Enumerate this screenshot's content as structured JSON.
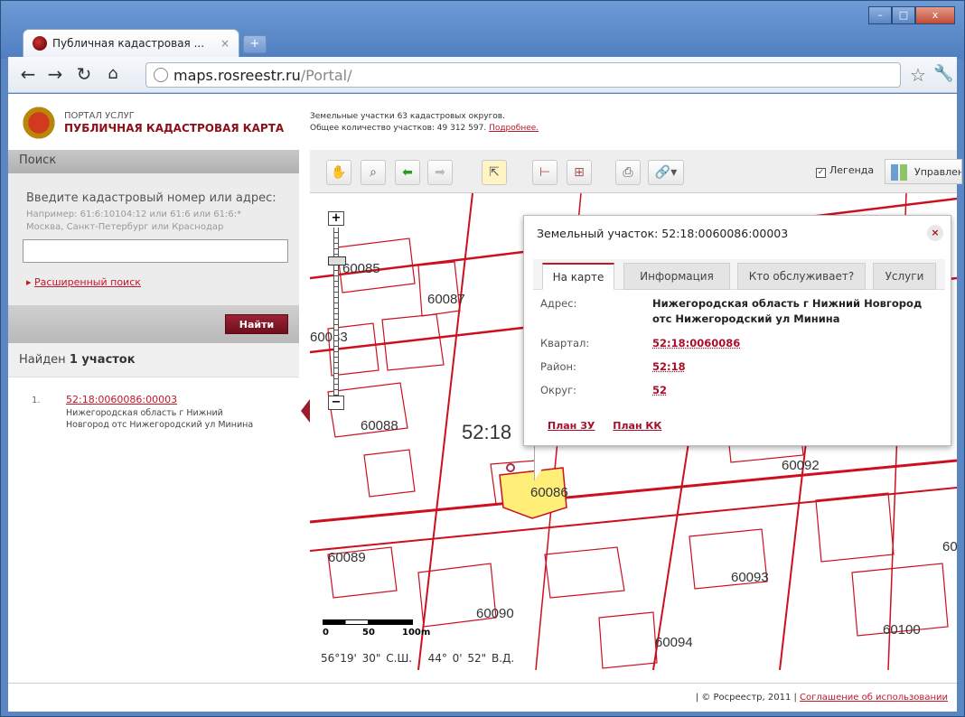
{
  "browser": {
    "tab_title": "Публичная кадастровая ...",
    "tab_close": "×",
    "new_tab": "+",
    "url_domain": "maps.rosreestr.ru",
    "url_path": "/Portal/",
    "win_min": "–",
    "win_max": "□",
    "win_close": "x"
  },
  "header": {
    "portal": "ПОРТАЛ УСЛУГ",
    "title": "ПУБЛИЧНАЯ КАДАСТРОВАЯ КАРТА",
    "info_line1": "Земельные участки 63 кадастровых округов.",
    "info_line2": "Общее количество участков: 49 312 597.",
    "info_more": "Подробнее."
  },
  "sidebar": {
    "title": "Поиск",
    "prompt": "Введите кадастровый номер или адрес:",
    "example1": "Например: 61:6:10104:12 или 61:6 или 61:6:*",
    "example2": "Москва, Санкт-Петербург или Краснодар",
    "advanced": "Расширенный поиск",
    "find_button": "Найти",
    "found_prefix": "Найден",
    "found_count": "1 участок",
    "result": {
      "index": "1.",
      "number": "52:18:0060086:00003",
      "address1": "Нижегородская область г Нижний",
      "address2": "Новгород отс Нижегородский ул Минина"
    }
  },
  "map_toolbar": {
    "legend": "Легенда",
    "management": "Управление"
  },
  "map": {
    "labels": [
      "60085",
      "60087",
      "60083",
      "60088",
      "52:18",
      "60086",
      "60092",
      "60089",
      "60090",
      "60093",
      "60094",
      "60100",
      "60"
    ],
    "scale": [
      "0",
      "50",
      "100m"
    ],
    "lat": "56°19' 30\" С.Ш.",
    "lon": "44° 0' 52\" В.Д."
  },
  "popup": {
    "title": "Земельный участок: 52:18:0060086:00003",
    "close": "×",
    "tabs": [
      "На карте",
      "Информация",
      "Кто обслуживает?",
      "Услуги"
    ],
    "address_label": "Адрес:",
    "address_1": "Нижегородская область г Нижний Новгород",
    "address_2": "отс Нижегородский ул Минина",
    "block_label": "Квартал:",
    "block": "52:18:0060086",
    "district_label": "Район:",
    "district": "52:18",
    "okrug_label": "Округ:",
    "okrug": "52",
    "plan_zu": "План ЗУ",
    "plan_kk": "План КК"
  },
  "footer": {
    "copyright": "| © Росреестр, 2011 |",
    "agreement": "Соглашение об использовании"
  },
  "colors": {
    "brand": "#8b1018",
    "parcel_line": "#cc1020",
    "parcel_fill": "#ffee77"
  }
}
